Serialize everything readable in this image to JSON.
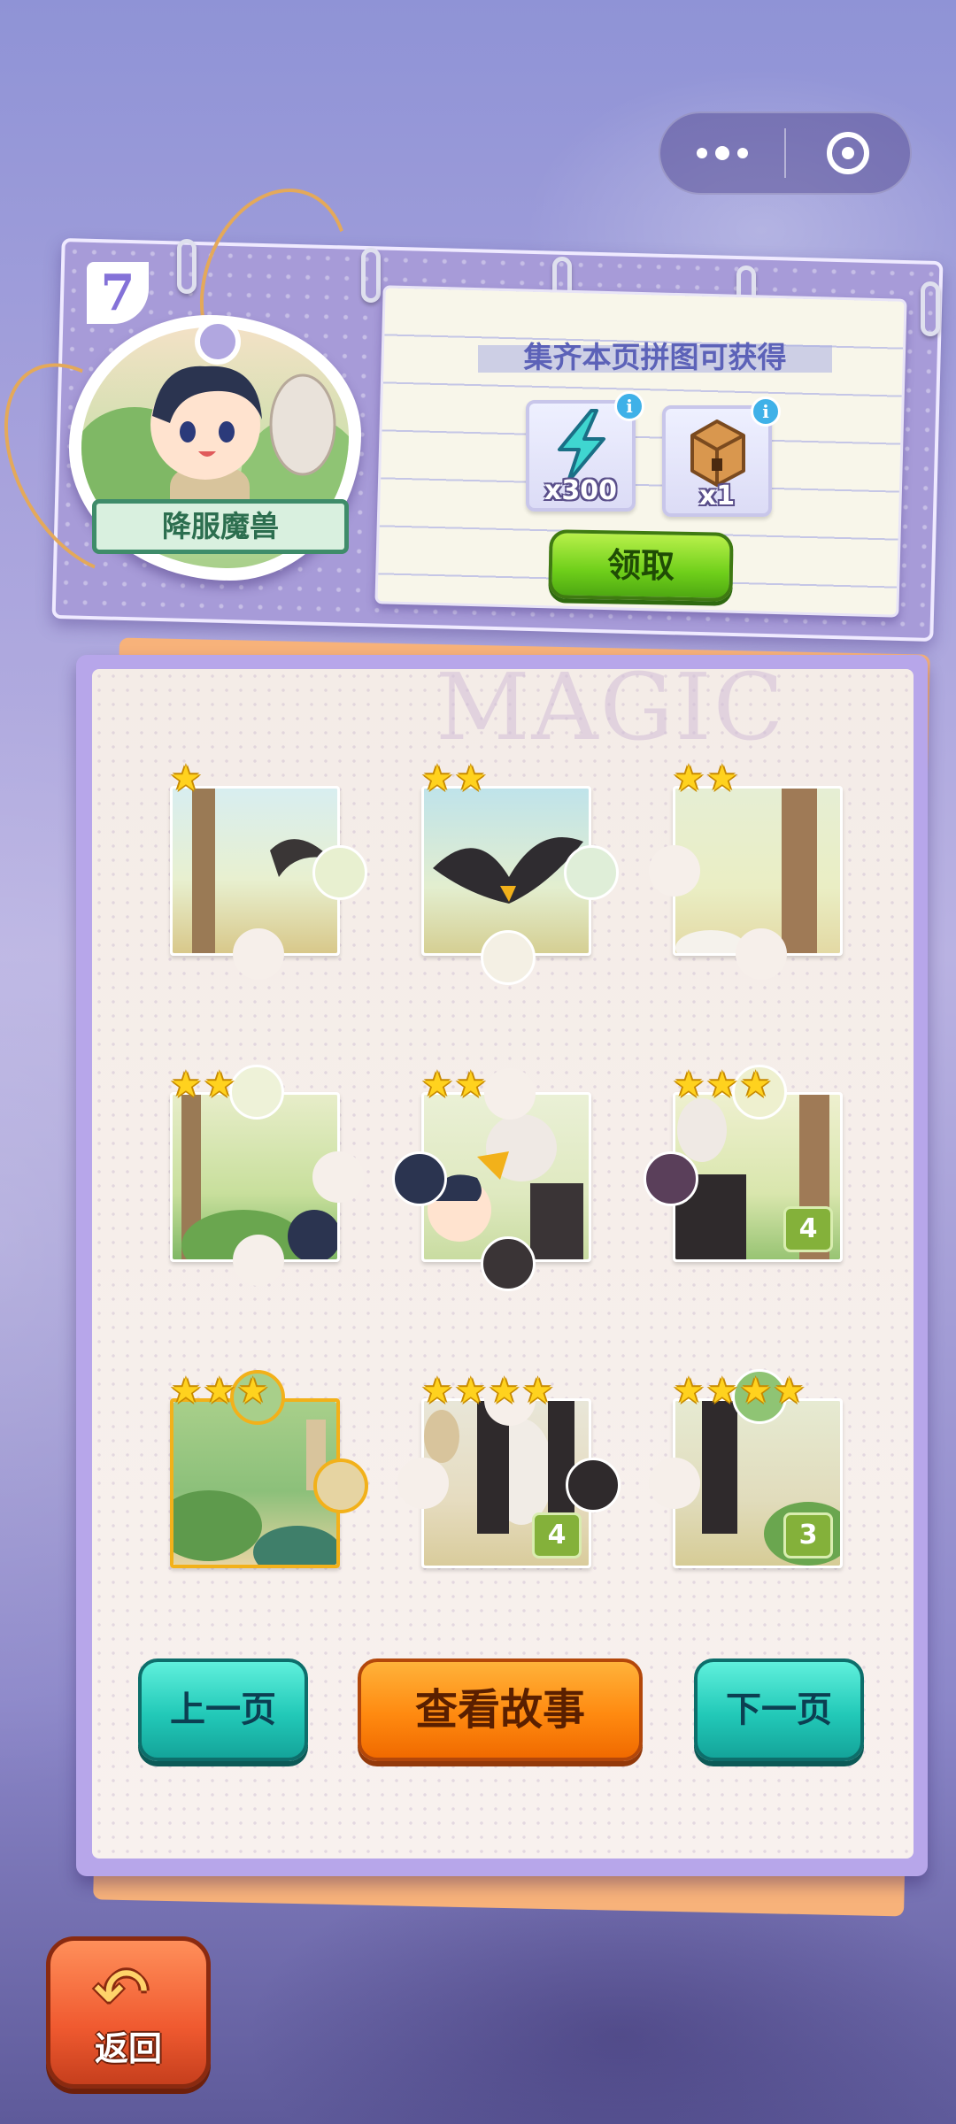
{
  "menu": {
    "more_icon": "more-dots-icon",
    "close_icon": "target-close-icon"
  },
  "header": {
    "page_number": "7",
    "badge_title": "降服魔兽",
    "reward_title": "集齐本页拼图可获得",
    "rewards": [
      {
        "icon": "lightning-energy-icon",
        "quantity": "x300"
      },
      {
        "icon": "wooden-chest-icon",
        "quantity": "x1"
      }
    ],
    "claim_label": "领取"
  },
  "board": {
    "watermark": "MAGIC",
    "pieces": [
      {
        "stars": 1,
        "count": ""
      },
      {
        "stars": 2,
        "count": ""
      },
      {
        "stars": 2,
        "count": ""
      },
      {
        "stars": 2,
        "count": ""
      },
      {
        "stars": 2,
        "count": ""
      },
      {
        "stars": 3,
        "count": "4"
      },
      {
        "stars": 3,
        "count": "",
        "selected": true
      },
      {
        "stars": 4,
        "count": "4"
      },
      {
        "stars": 4,
        "count": "3"
      }
    ]
  },
  "buttons": {
    "prev_label": "上一页",
    "story_label": "查看故事",
    "next_label": "下一页",
    "back_label": "返回"
  },
  "colors": {
    "accent_green": "#6fcf1a",
    "accent_teal": "#22c9b8",
    "accent_orange": "#ff8a10",
    "star": "#ffd21e"
  }
}
